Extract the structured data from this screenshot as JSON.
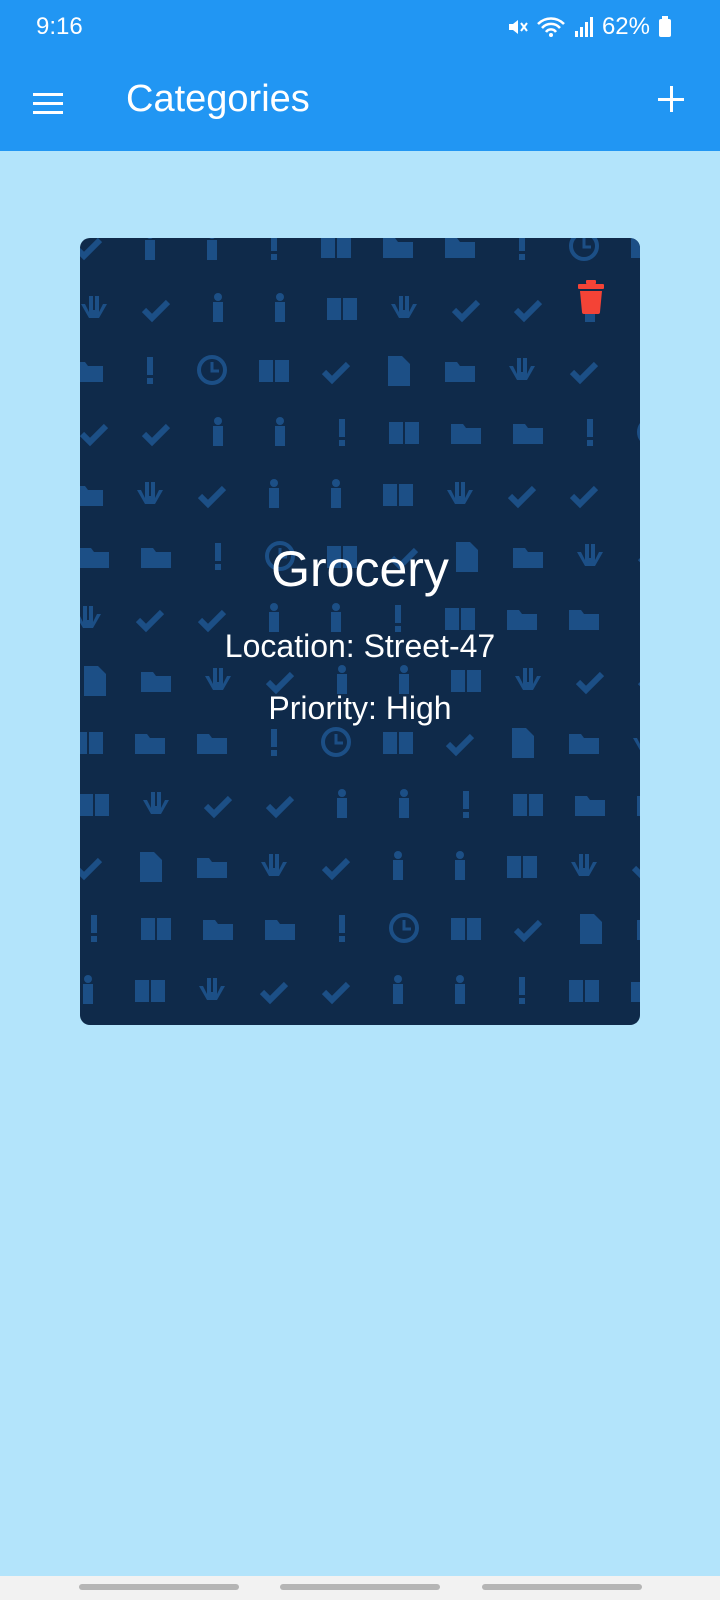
{
  "status_bar": {
    "time": "9:16",
    "battery": "62%",
    "icons": [
      "mute-icon",
      "wifi-icon",
      "signal-icon",
      "battery-icon"
    ]
  },
  "app_bar": {
    "title": "Categories",
    "menu_icon": "hamburger-menu-icon",
    "add_icon": "plus-icon",
    "color": "#2196f3"
  },
  "category": {
    "name": "Grocery",
    "location": "Location: Street-47",
    "priority": "Priority: High",
    "delete_icon": "trash-icon",
    "delete_color": "#f44336",
    "card_color": "#0f2a4a"
  },
  "colors": {
    "background": "#b3e4fb",
    "pattern": "#1c4f86"
  }
}
